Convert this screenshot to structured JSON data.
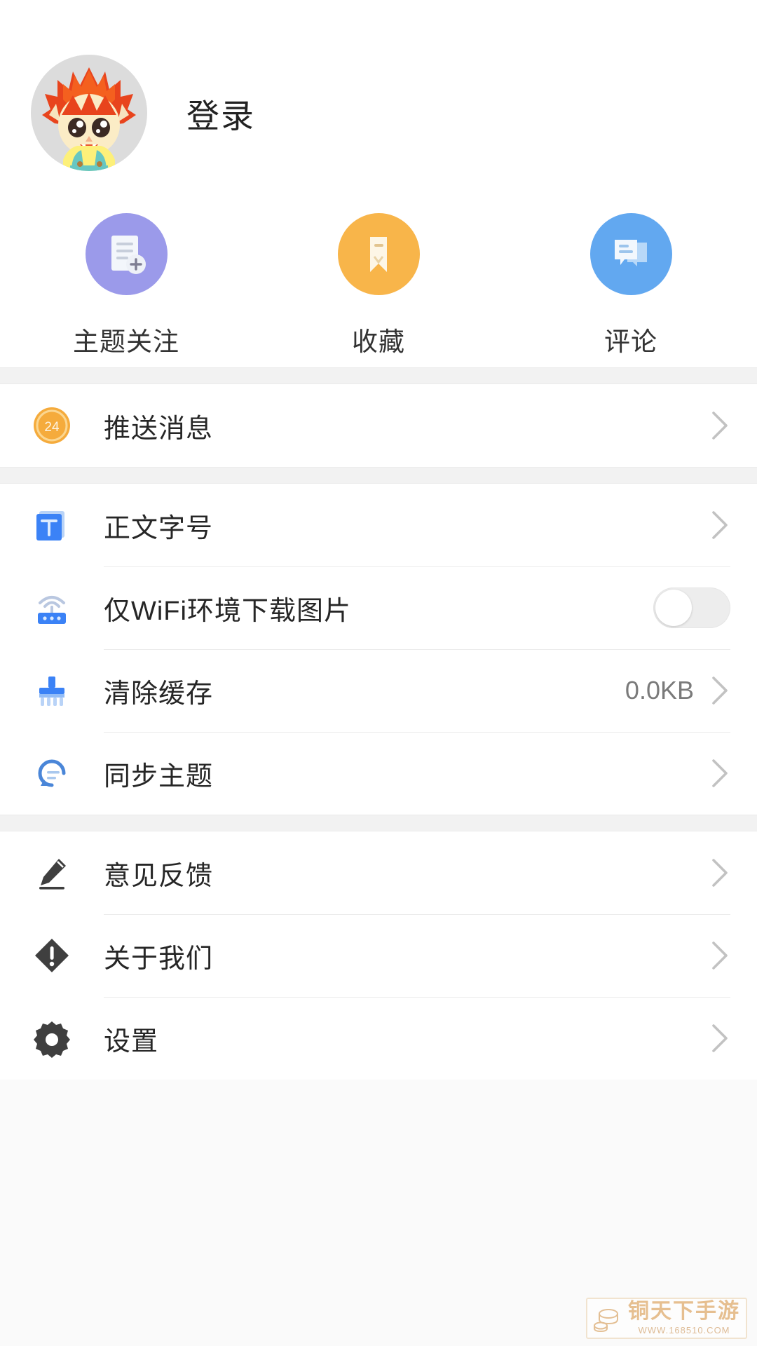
{
  "profile": {
    "avatar_icon": "cartoon-hedgehog-avatar",
    "login_label": "登录"
  },
  "quick_actions": [
    {
      "label": "主题关注",
      "icon": "document-add-icon",
      "color": "#9b9aea"
    },
    {
      "label": "收藏",
      "icon": "bookmark-icon",
      "color": "#f8b54a"
    },
    {
      "label": "评论",
      "icon": "comment-bubbles-icon",
      "color": "#62a8f0"
    }
  ],
  "groups": [
    {
      "rows": [
        {
          "label": "推送消息",
          "icon": "push-badge-24-icon",
          "badge_count": "24",
          "value": "",
          "control": "chevron"
        }
      ]
    },
    {
      "rows": [
        {
          "label": "正文字号",
          "icon": "text-size-icon",
          "value": "",
          "control": "chevron"
        },
        {
          "label": "仅WiFi环境下载图片",
          "icon": "wifi-router-icon",
          "value": "",
          "control": "toggle",
          "toggle_on": false
        },
        {
          "label": "清除缓存",
          "icon": "broom-icon",
          "value": "0.0KB",
          "control": "chevron"
        },
        {
          "label": "同步主题",
          "icon": "sync-refresh-icon",
          "value": "",
          "control": "chevron"
        }
      ]
    },
    {
      "rows": [
        {
          "label": "意见反馈",
          "icon": "pencil-edit-icon",
          "value": "",
          "control": "chevron"
        },
        {
          "label": "关于我们",
          "icon": "info-diamond-icon",
          "value": "",
          "control": "chevron"
        },
        {
          "label": "设置",
          "icon": "gear-icon",
          "value": "",
          "control": "chevron"
        }
      ]
    }
  ],
  "watermark": {
    "title": "铜天下手游",
    "url": "WWW.168510.COM",
    "icon": "coins-icon"
  }
}
